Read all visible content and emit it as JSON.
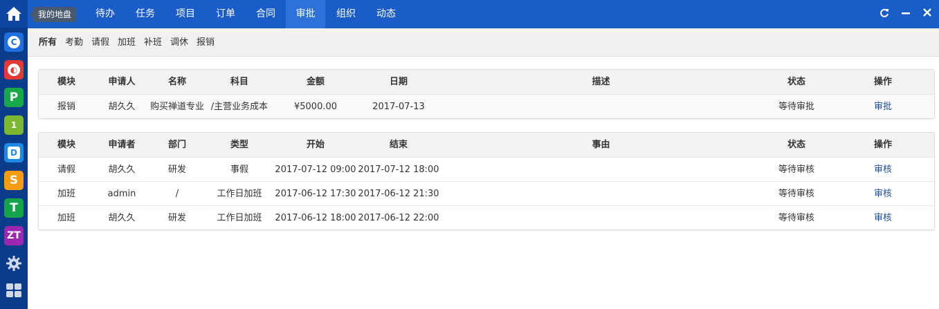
{
  "tooltip": "我的地盘",
  "nav": {
    "items": [
      "待办",
      "任务",
      "项目",
      "订单",
      "合同",
      "审批",
      "组织",
      "动态"
    ],
    "active_index": 5
  },
  "window_controls": {
    "refresh": "C",
    "minimize": "—",
    "close": "✕"
  },
  "dock": {
    "apps": [
      {
        "icon": "c-app-icon",
        "letter": "C",
        "color": "#1e6fe0"
      },
      {
        "icon": "o-app-icon",
        "letter": "◐",
        "color": "#e53935"
      },
      {
        "icon": "p-app-icon",
        "letter": "P",
        "color": "#18a84a"
      },
      {
        "icon": "one-app-icon",
        "letter": "1",
        "color": "#7cb82f"
      },
      {
        "icon": "d-app-icon",
        "letter": "D",
        "color": "#1e88e5"
      },
      {
        "icon": "s-app-icon",
        "letter": "S",
        "color": "#f39c12"
      },
      {
        "icon": "t-app-icon",
        "letter": "T",
        "color": "#16a34a"
      },
      {
        "icon": "zt-app-icon",
        "letter": "ZT",
        "color": "#9c27b0"
      }
    ]
  },
  "subnav": {
    "items": [
      "所有",
      "考勤",
      "请假",
      "加班",
      "补班",
      "调休",
      "报销"
    ],
    "active_index": 0
  },
  "reimburse_table": {
    "headers": [
      "模块",
      "申请人",
      "名称",
      "科目",
      "金额",
      "日期",
      "描述",
      "状态",
      "操作"
    ],
    "rows": [
      [
        "报销",
        "胡久久",
        "购买禅道专业",
        "/主营业务成本",
        "¥5000.00",
        "2017-07-13",
        "",
        "等待审批",
        "审批"
      ]
    ]
  },
  "leave_table": {
    "headers": [
      "模块",
      "申请者",
      "部门",
      "类型",
      "开始",
      "结束",
      "事由",
      "状态",
      "操作"
    ],
    "rows": [
      [
        "请假",
        "胡久久",
        "研发",
        "事假",
        "2017-07-12 09:00",
        "2017-07-12 18:00",
        "",
        "等待审核",
        "审核"
      ],
      [
        "加班",
        "admin",
        "/",
        "工作日加班",
        "2017-06-12 17:30",
        "2017-06-12 21:30",
        "",
        "等待审核",
        "审核"
      ],
      [
        "加班",
        "胡久久",
        "研发",
        "工作日加班",
        "2017-06-12 18:00",
        "2017-06-12 22:00",
        "",
        "等待审核",
        "审核"
      ]
    ]
  },
  "colors": {
    "topbar": "#1a5cc8",
    "active_tab": "#2e72d9",
    "dock": "#0b3c8a",
    "link": "#1a4fa0"
  }
}
